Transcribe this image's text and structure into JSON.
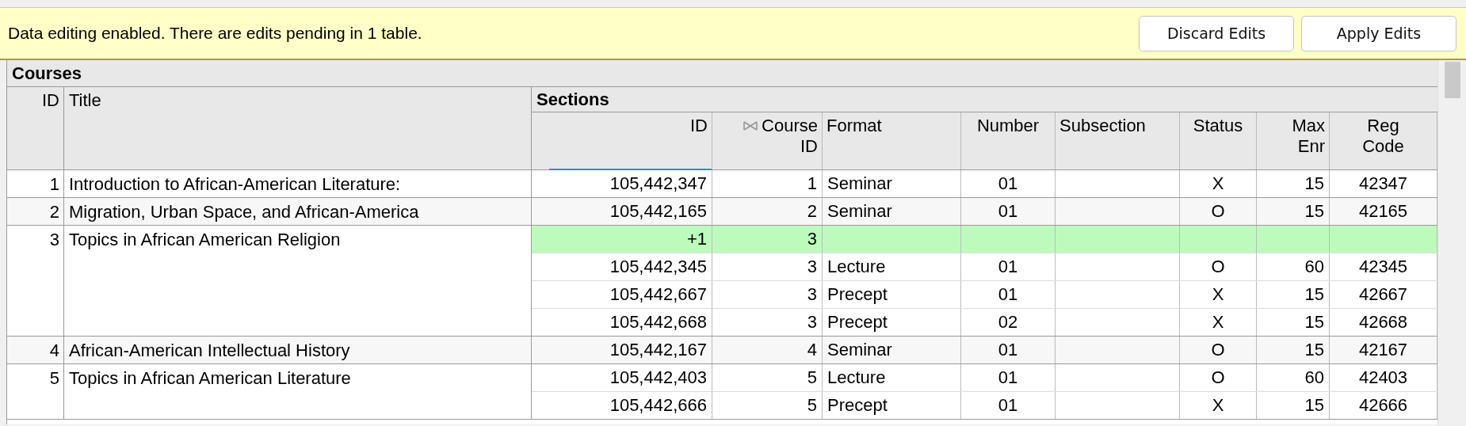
{
  "notice": {
    "message": "Data editing enabled. There are edits pending in 1 table.",
    "buttons": [
      "Discard Edits",
      "Apply Edits"
    ]
  },
  "table": {
    "title": "Courses",
    "columns": [
      {
        "label": "ID"
      },
      {
        "label": "Title"
      }
    ],
    "sections": {
      "title": "Sections",
      "columns": [
        {
          "label": "ID",
          "kind": "plain",
          "selected": true
        },
        {
          "label": "Course ID",
          "kind": "join",
          "selected": false
        },
        {
          "label": "Format",
          "kind": "plain",
          "selected": false
        },
        {
          "label": "Number",
          "kind": "plain",
          "selected": false
        },
        {
          "label": "Subsection",
          "kind": "plain",
          "selected": false
        },
        {
          "label": "Status",
          "kind": "plain",
          "selected": false
        },
        {
          "label": "Max Enr",
          "kind": "plain",
          "selected": false
        },
        {
          "label": "Reg Code",
          "kind": "plain",
          "selected": false
        }
      ]
    },
    "rows": [
      {
        "id": "1",
        "title": "Introduction to African-American Literature:",
        "sections": [
          {
            "kind": "saved",
            "id": "105,442,347",
            "course_id": "1",
            "format": "Seminar",
            "number": "01",
            "status": "X",
            "max_enr": "15",
            "reg_code": "42347"
          }
        ]
      },
      {
        "id": "2",
        "title": "Migration, Urban Space, and African-America",
        "sections": [
          {
            "kind": "saved",
            "id": "105,442,165",
            "course_id": "2",
            "format": "Seminar",
            "number": "01",
            "status": "O",
            "max_enr": "15",
            "reg_code": "42165"
          }
        ]
      },
      {
        "id": "3",
        "title": "Topics in African American Religion",
        "sections": [
          {
            "kind": "pending",
            "id": "+1",
            "course_id": "3"
          },
          {
            "kind": "saved",
            "id": "105,442,345",
            "course_id": "3",
            "format": "Lecture",
            "number": "01",
            "status": "O",
            "max_enr": "60",
            "reg_code": "42345"
          },
          {
            "kind": "saved",
            "id": "105,442,667",
            "course_id": "3",
            "format": "Precept",
            "number": "01",
            "status": "X",
            "max_enr": "15",
            "reg_code": "42667"
          },
          {
            "kind": "saved",
            "id": "105,442,668",
            "course_id": "3",
            "format": "Precept",
            "number": "02",
            "status": "X",
            "max_enr": "15",
            "reg_code": "42668"
          }
        ]
      },
      {
        "id": "4",
        "title": "African-American Intellectual History",
        "sections": [
          {
            "kind": "saved",
            "id": "105,442,167",
            "course_id": "4",
            "format": "Seminar",
            "number": "01",
            "status": "O",
            "max_enr": "15",
            "reg_code": "42167"
          }
        ]
      },
      {
        "id": "5",
        "title": "Topics in African American Literature",
        "sections": [
          {
            "kind": "saved",
            "id": "105,442,403",
            "course_id": "5",
            "format": "Lecture",
            "number": "01",
            "status": "O",
            "max_enr": "60",
            "reg_code": "42403"
          },
          {
            "kind": "saved",
            "id": "105,442,666",
            "course_id": "5",
            "format": "Precept",
            "number": "01",
            "status": "X",
            "max_enr": "15",
            "reg_code": "42666"
          }
        ]
      }
    ]
  }
}
